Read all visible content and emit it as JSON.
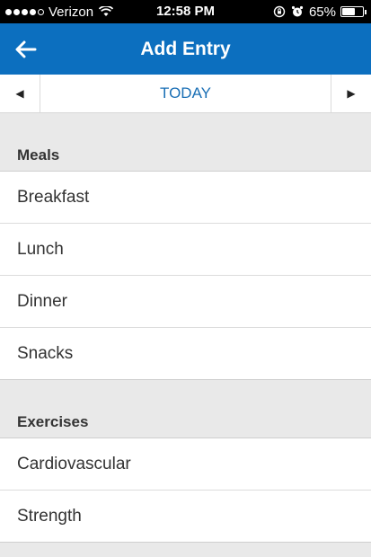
{
  "status": {
    "carrier": "Verizon",
    "time": "12:58 PM",
    "battery": "65%",
    "battery_level": 0.65
  },
  "header": {
    "title": "Add Entry",
    "back_icon": "back-arrow-icon"
  },
  "date_nav": {
    "label": "TODAY",
    "prev_icon": "triangle-left-icon",
    "next_icon": "triangle-right-icon"
  },
  "sections": [
    {
      "title": "Meals",
      "items": [
        "Breakfast",
        "Lunch",
        "Dinner",
        "Snacks"
      ]
    },
    {
      "title": "Exercises",
      "items": [
        "Cardiovascular",
        "Strength"
      ]
    }
  ],
  "colors": {
    "brand": "#0c6fbf",
    "link": "#1a6fb5",
    "background": "#e9e9e9"
  }
}
